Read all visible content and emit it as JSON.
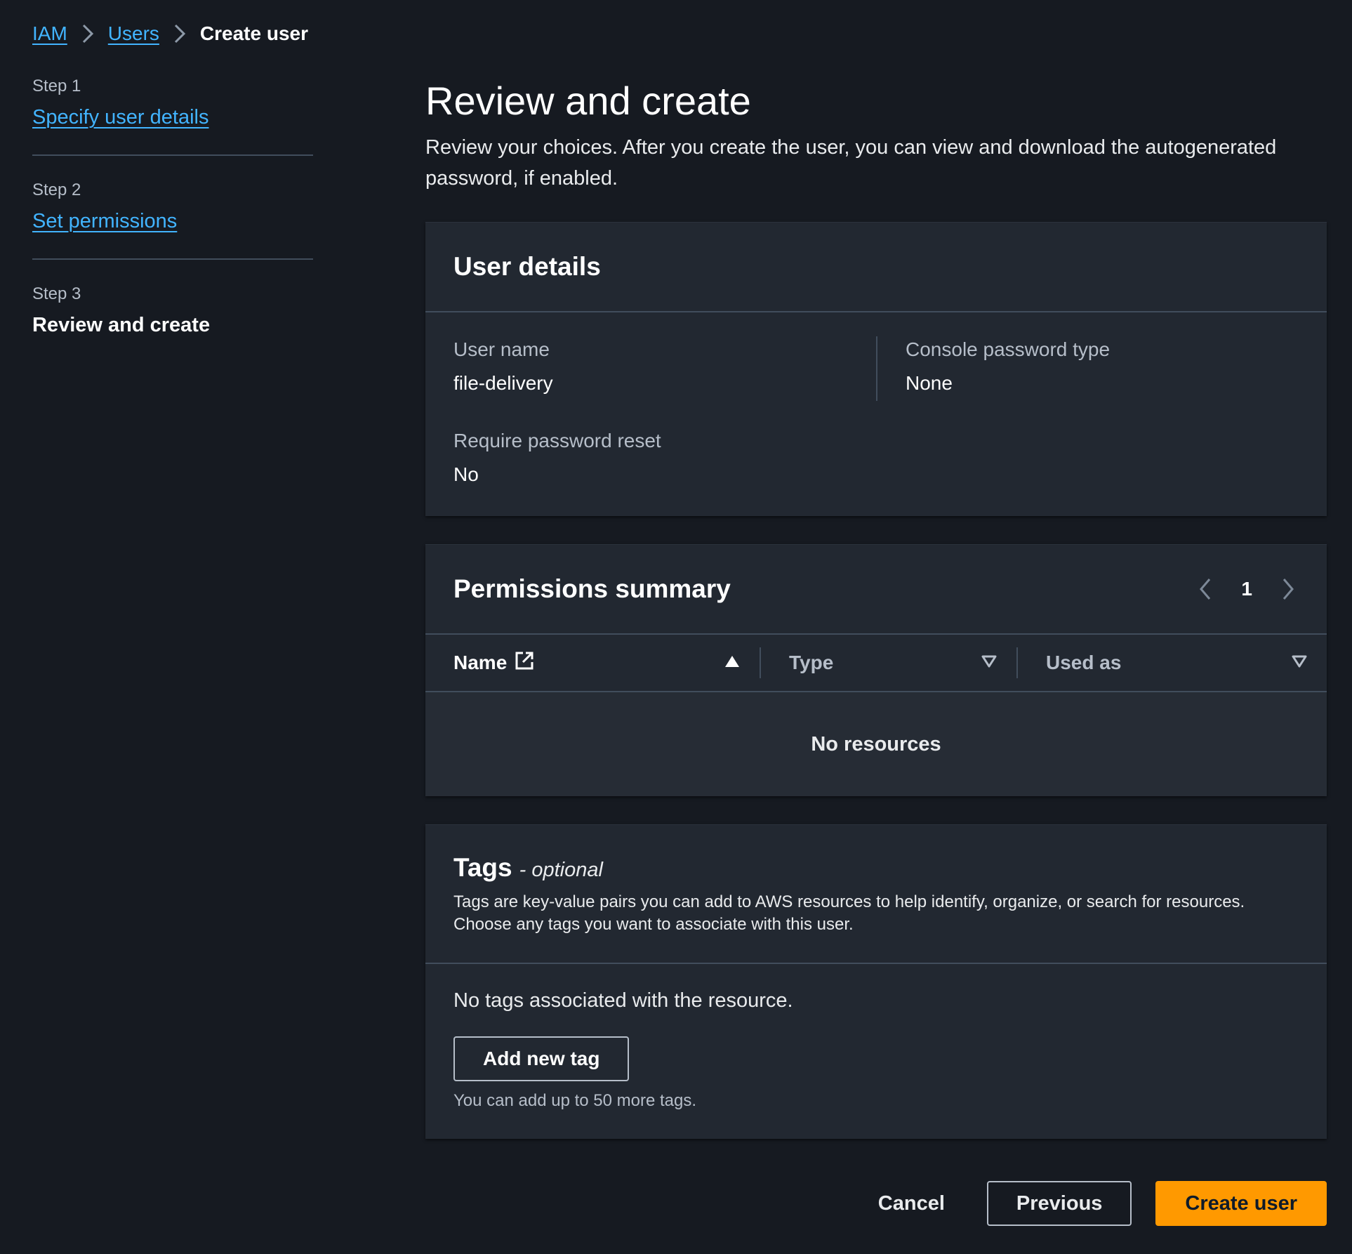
{
  "breadcrumb": {
    "items": [
      "IAM",
      "Users"
    ],
    "current": "Create user"
  },
  "steps": [
    {
      "num": "Step 1",
      "label": "Specify user details"
    },
    {
      "num": "Step 2",
      "label": "Set permissions"
    },
    {
      "num": "Step 3",
      "label": "Review and create"
    }
  ],
  "main": {
    "title": "Review and create",
    "description": "Review your choices. After you create the user, you can view and download the autogenerated password, if enabled."
  },
  "user_details": {
    "title": "User details",
    "user_name_label": "User name",
    "user_name_value": "file-delivery",
    "console_password_label": "Console password type",
    "console_password_value": "None",
    "require_reset_label": "Require password reset",
    "require_reset_value": "No"
  },
  "permissions": {
    "title": "Permissions summary",
    "page": "1",
    "columns": [
      "Name",
      "Type",
      "Used as"
    ],
    "empty_text": "No resources"
  },
  "tags": {
    "title": "Tags",
    "optional": "- optional",
    "description": "Tags are key-value pairs you can add to AWS resources to help identify, organize, or search for resources. Choose any tags you want to associate with this user.",
    "no_tags": "No tags associated with the resource.",
    "add_button": "Add new tag",
    "hint": "You can add up to 50 more tags."
  },
  "actions": {
    "cancel": "Cancel",
    "previous": "Previous",
    "create": "Create user"
  },
  "colors": {
    "background": "#161a21",
    "card": "#222831",
    "link": "#42b4ff",
    "primary": "#ff9900",
    "divider": "#414d5c"
  }
}
